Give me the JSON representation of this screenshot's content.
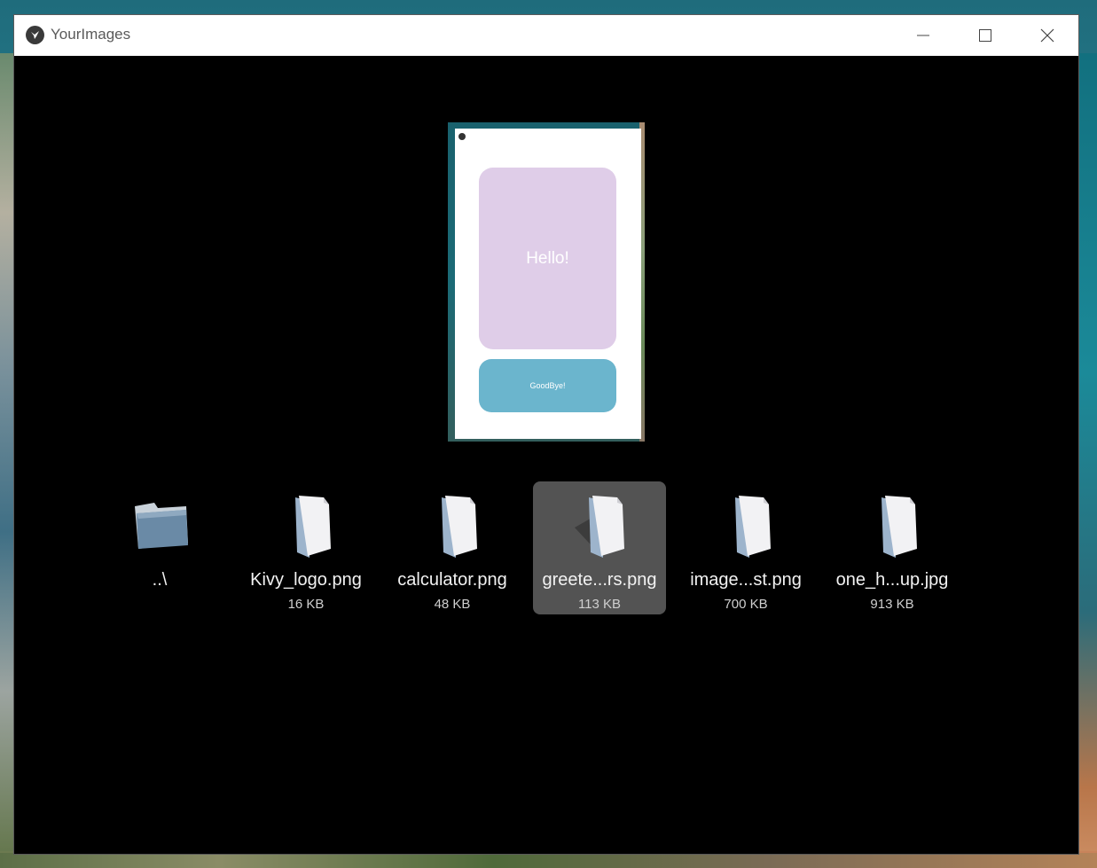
{
  "window": {
    "title": "YourImages",
    "controls": [
      "minimize-icon",
      "maximize-icon",
      "close-icon"
    ]
  },
  "preview": {
    "selected_file": "greete...rs.png",
    "card_text": "Hello!",
    "button_text": "GoodBye!",
    "colors": {
      "card": "#dfcde8",
      "button": "#6bb5cd"
    }
  },
  "files": [
    {
      "name": "..\\",
      "size": "",
      "icon": "folder-icon",
      "selected": false
    },
    {
      "name": "Kivy_logo.png",
      "size": "16 KB",
      "icon": "file-icon",
      "selected": false
    },
    {
      "name": "calculator.png",
      "size": "48 KB",
      "icon": "file-icon",
      "selected": false
    },
    {
      "name": "greete...rs.png",
      "size": "113 KB",
      "icon": "file-icon",
      "selected": true
    },
    {
      "name": "image...st.png",
      "size": "700 KB",
      "icon": "file-icon",
      "selected": false
    },
    {
      "name": "one_h...up.jpg",
      "size": "913 KB",
      "icon": "file-icon",
      "selected": false
    }
  ],
  "colors": {
    "background": "#000000",
    "selection": "#535353",
    "text": "#f2f2f2"
  }
}
